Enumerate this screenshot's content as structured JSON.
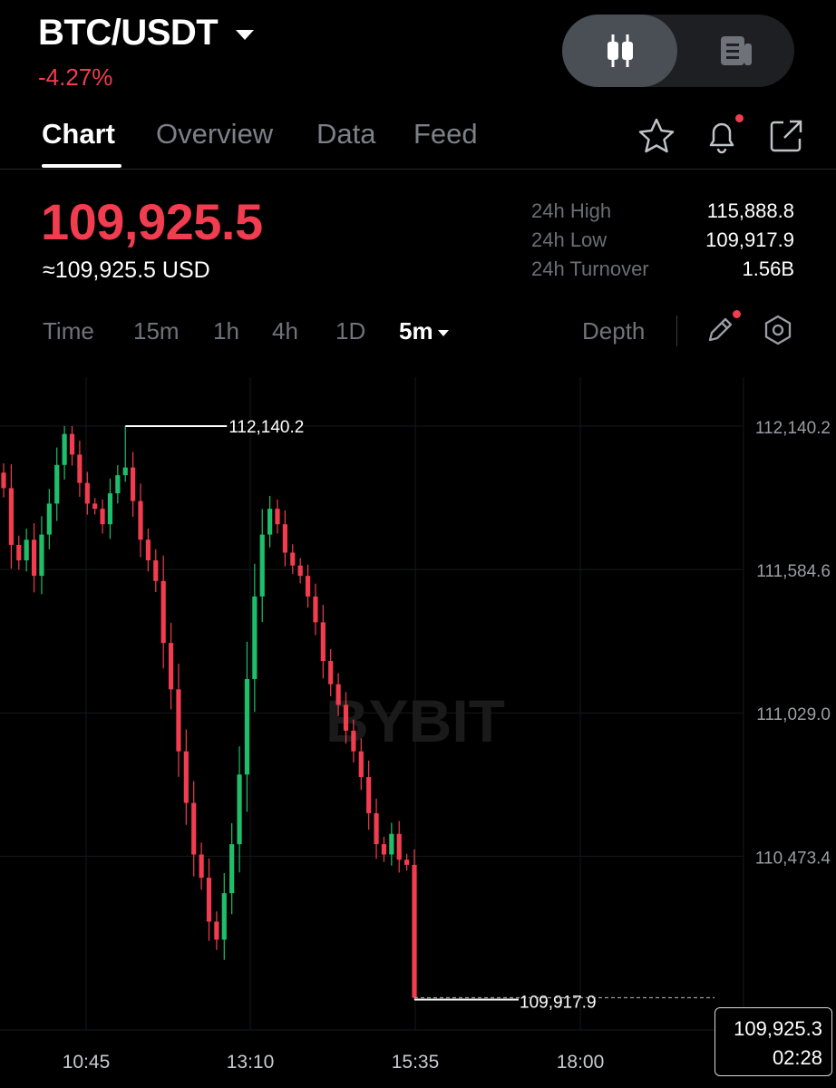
{
  "header": {
    "pair": "BTC/USDT",
    "change": "-4.27%"
  },
  "tabs": [
    {
      "label": "Chart",
      "active": true
    },
    {
      "label": "Overview",
      "active": false
    },
    {
      "label": "Data",
      "active": false
    },
    {
      "label": "Feed",
      "active": false
    }
  ],
  "icons": [
    "star-icon",
    "bell-icon",
    "share-icon",
    "candlestick-icon",
    "document-icon",
    "pencil-icon",
    "settings-hexagon-icon"
  ],
  "price": {
    "last": "109,925.5",
    "usd": "≈109,925.5 USD"
  },
  "stats": [
    {
      "label": "24h High",
      "value": "115,888.8"
    },
    {
      "label": "24h Low",
      "value": "109,917.9"
    },
    {
      "label": "24h Turnover",
      "value": "1.56B"
    }
  ],
  "timeframes": {
    "items": [
      "Time",
      "15m",
      "1h",
      "4h",
      "1D"
    ],
    "selected": "5m",
    "depth": "Depth"
  },
  "colors": {
    "up": "#1fbe6b",
    "down": "#f23c4f",
    "background": "#000000"
  },
  "chart_data": {
    "type": "candlestick",
    "watermark": "BYBIT",
    "y_ticks": [
      "112,140.2",
      "111,584.6",
      "111,029.0",
      "110,473.4"
    ],
    "x_ticks": [
      "10:45",
      "13:10",
      "15:35",
      "18:00"
    ],
    "high_marker": "112,140.2",
    "low_marker": "109,917.9",
    "last_price": "109,925.3",
    "countdown": "02:28",
    "ylim": [
      109800,
      112330
    ],
    "closes": [
      111900,
      111680,
      111620,
      111700,
      111560,
      111720,
      111840,
      111990,
      112110,
      112030,
      111920,
      111840,
      111820,
      111760,
      111880,
      111950,
      111980,
      111850,
      111700,
      111620,
      111540,
      111300,
      111120,
      110880,
      110680,
      110480,
      110390,
      110220,
      110150,
      110330,
      110520,
      110790,
      111160,
      111480,
      111720,
      111820,
      111760,
      111650,
      111600,
      111560,
      111480,
      111380,
      111230,
      111140,
      111060,
      110960,
      110880,
      110780,
      110640,
      110520,
      110480,
      110560,
      110460,
      110440,
      109925
    ]
  }
}
